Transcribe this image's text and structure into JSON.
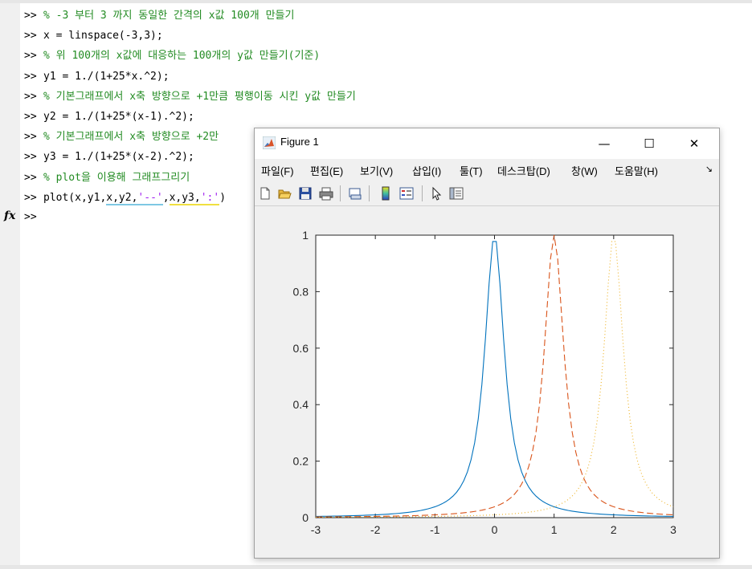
{
  "command_window": {
    "prompt": ">>",
    "lines": [
      {
        "type": "comment",
        "text": "% -3 부터 3 까지 동일한 간격의 x값 100개 만들기"
      },
      {
        "type": "code",
        "text": "x = linspace(-3,3);"
      },
      {
        "type": "comment",
        "text": "% 위 100개의 x값에 대응하는 100개의 y값 만들기(기준)"
      },
      {
        "type": "code",
        "text": "y1 = 1./(1+25*x.^2);"
      },
      {
        "type": "comment",
        "text": "% 기본그래프에서 x축 방향으로 +1만큼 평행이동 시킨 y값 만들기"
      },
      {
        "type": "code",
        "text": "y2 = 1./(1+25*(x-1).^2);"
      },
      {
        "type": "comment",
        "text": "% 기본그래프에서 x축 방향으로 +2만"
      },
      {
        "type": "code",
        "text": "y3 = 1./(1+25*(x-2).^2);"
      },
      {
        "type": "comment",
        "text": "% plot을 이용해 그래프그리기"
      }
    ],
    "plot_cmd": {
      "part1": "plot(x,y1,",
      "part2": "x,y2,",
      "part3": "'--'",
      "part4": ",",
      "part5": "x,y3,",
      "part6": "':'",
      "part7": ")"
    },
    "fx_label": "fx",
    "fx_prompt": ">>"
  },
  "figure": {
    "title": "Figure 1",
    "icon": "matlab-logo-icon",
    "controls": {
      "minimize": "—",
      "maximize": "☐",
      "close": "✕"
    },
    "menus": [
      "파일(F)",
      "편집(E)",
      "보기(V)",
      "삽입(I)",
      "툴(T)",
      "데스크탑(D)",
      "창(W)",
      "도움말(H)"
    ],
    "menu_arrow": "↘",
    "toolbar_icons": [
      "new-figure-icon",
      "open-file-icon",
      "save-icon",
      "print-icon",
      "link-plot-icon",
      "insert-colorbar-icon",
      "insert-legend-icon",
      "edit-plot-icon",
      "property-inspector-icon"
    ]
  },
  "chart_data": {
    "type": "line",
    "title": "",
    "xlabel": "",
    "ylabel": "",
    "xlim": [
      -3,
      3
    ],
    "ylim": [
      0,
      1
    ],
    "xticks": [
      -3,
      -2,
      -1,
      0,
      1,
      2,
      3
    ],
    "yticks": [
      0,
      0.2,
      0.4,
      0.6,
      0.8,
      1
    ],
    "grid": false,
    "legend": "none",
    "series": [
      {
        "color": "#0072bd",
        "linestyle": "solid",
        "shift": 0
      },
      {
        "color": "#d95319",
        "linestyle": "dashed",
        "shift": 1
      },
      {
        "color": "#edb120",
        "linestyle": "dotted",
        "shift": 2
      }
    ],
    "x_samples": 100
  }
}
